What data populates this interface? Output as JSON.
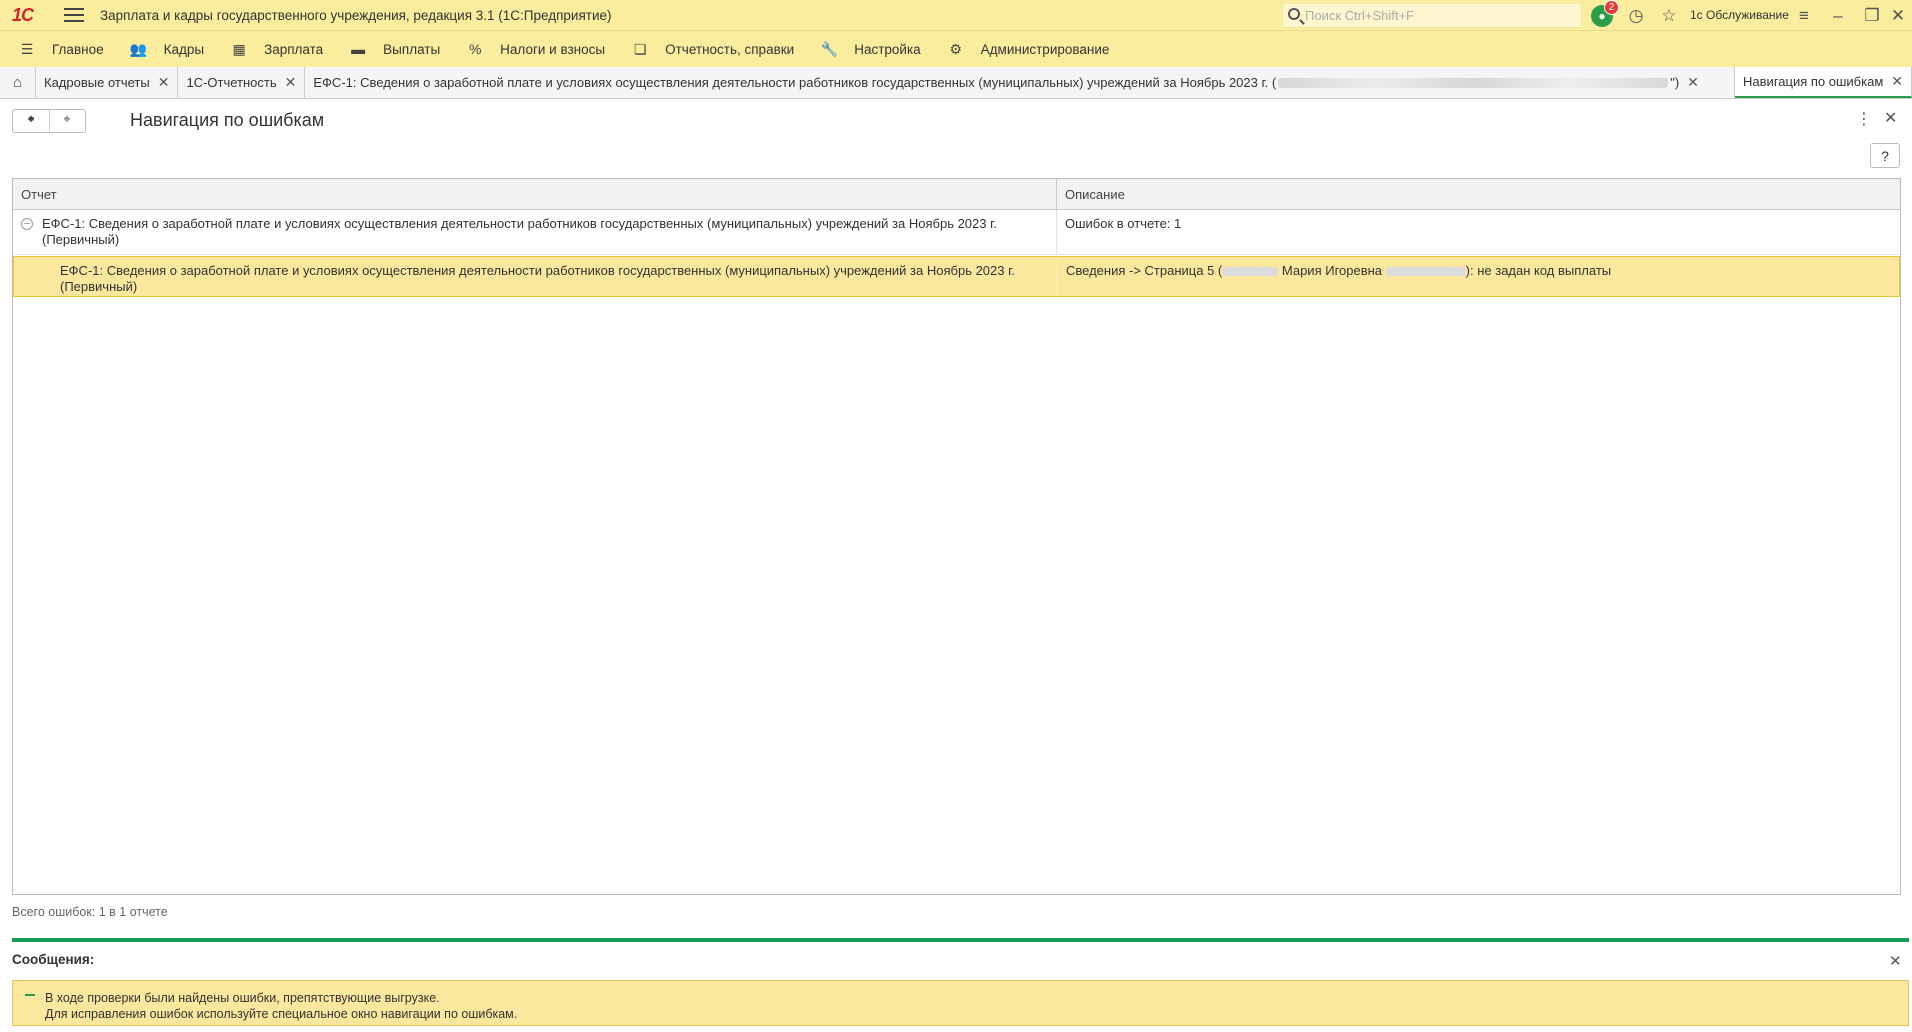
{
  "titlebar": {
    "logo": "1С",
    "app_title": "Зарплата и кадры государственного учреждения, редакция 3.1  (1С:Предприятие)",
    "search_placeholder": "Поиск Ctrl+Shift+F",
    "notifications_count": "2",
    "user": "1с Обслуживание"
  },
  "sections": [
    {
      "label": "Главное",
      "icon": "menu-icon"
    },
    {
      "label": "Кадры",
      "icon": "people-icon"
    },
    {
      "label": "Зарплата",
      "icon": "calculator-icon"
    },
    {
      "label": "Выплаты",
      "icon": "wallet-icon"
    },
    {
      "label": "Налоги и взносы",
      "icon": "percent-icon"
    },
    {
      "label": "Отчетность, справки",
      "icon": "documents-icon"
    },
    {
      "label": "Настройка",
      "icon": "wrench-icon"
    },
    {
      "label": "Администрирование",
      "icon": "gear-icon"
    }
  ],
  "tabs": [
    {
      "label": "Кадровые отчеты"
    },
    {
      "label": "1С-Отчетность"
    },
    {
      "label": "ЕФС-1: Сведения о заработной плате и условиях осуществления деятельности работников государственных (муниципальных) учреждений за Ноябрь 2023 г. (",
      "suffix": "\")"
    },
    {
      "label": "Навигация по ошибкам"
    }
  ],
  "form": {
    "title": "Навигация по ошибкам",
    "help_label": "?"
  },
  "table": {
    "headers": [
      "Отчет",
      "Описание"
    ],
    "group_row": {
      "report": "ЕФС-1: Сведения о заработной плате и условиях осуществления деятельности работников государственных (муниципальных) учреждений за Ноябрь 2023 г. (Первичный)",
      "description": "Ошибок в отчете: 1"
    },
    "detail_row": {
      "report": "ЕФС-1: Сведения о заработной плате и условиях осуществления деятельности работников государственных (муниципальных) учреждений за Ноябрь 2023 г. (Первичный)",
      "description_prefix": "Сведения -> Страница 5 (",
      "description_name": "Мария Игоревна",
      "description_suffix": "): не задан код выплаты"
    }
  },
  "total": "Всего ошибок: 1 в 1 отчете",
  "messages": {
    "title": "Сообщения:",
    "line1": "В ходе проверки были найдены ошибки, препятствующие выгрузке.",
    "line2": "Для исправления ошибок используйте специальное окно навигации по ошибкам."
  },
  "colors": {
    "panel_yellow": "#fbed9e",
    "selection_yellow": "#fbe79e",
    "accent_green": "#2a9d4b",
    "logo_red": "#d2232a"
  }
}
